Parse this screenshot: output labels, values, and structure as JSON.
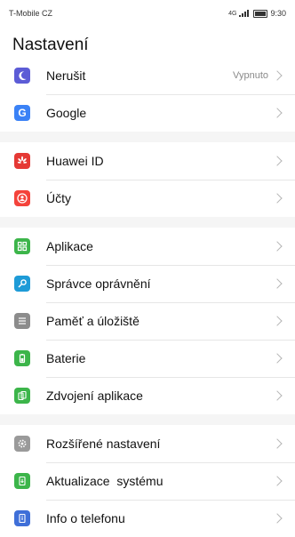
{
  "status": {
    "carrier": "T-Mobile CZ",
    "time": "9:30",
    "network": "4G"
  },
  "header": {
    "title": "Nastavení"
  },
  "groups": [
    {
      "items": [
        {
          "label": "Nerušit",
          "value": "Vypnuto",
          "icon": "moon-icon",
          "color": "#5c5cd6"
        },
        {
          "label": "Google",
          "icon": "google-icon",
          "color": "#3b82f6"
        }
      ]
    },
    {
      "items": [
        {
          "label": "Huawei ID",
          "icon": "huawei-icon",
          "color": "#e53935"
        },
        {
          "label": "Účty",
          "icon": "accounts-icon",
          "color": "#f4433b"
        }
      ]
    },
    {
      "items": [
        {
          "label": "Aplikace",
          "icon": "apps-icon",
          "color": "#3cb54a"
        },
        {
          "label": "Správce oprávnění",
          "icon": "key-icon",
          "color": "#1e9bd7"
        },
        {
          "label": "Paměť a úložiště",
          "icon": "storage-icon",
          "color": "#8c8c8c"
        },
        {
          "label": "Baterie",
          "icon": "battery-icon",
          "color": "#3cb54a"
        },
        {
          "label": "Zdvojení aplikace",
          "icon": "app-twin-icon",
          "color": "#3cb54a"
        }
      ]
    },
    {
      "items": [
        {
          "label": "Rozšířené nastavení",
          "icon": "gear-icon",
          "color": "#9a9a9a"
        },
        {
          "label": "Aktualizace  systému",
          "icon": "system-update-icon",
          "color": "#3cb54a"
        },
        {
          "label": "Info o telefonu",
          "icon": "phone-info-icon",
          "color": "#3f6fd8"
        }
      ]
    }
  ]
}
